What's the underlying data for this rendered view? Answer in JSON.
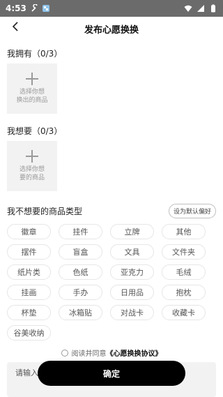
{
  "status_bar": {
    "time": "4:53",
    "left_icons": [
      "wrench-icon",
      "app-notification-icon"
    ],
    "right_icons": [
      "wifi-icon",
      "signal-icon",
      "battery-icon"
    ]
  },
  "header": {
    "title": "发布心愿换换",
    "back_icon": "chevron-left-icon"
  },
  "have_section": {
    "label": "我拥有（0/3）",
    "upload_text": "选择你想\n换出的商品"
  },
  "want_section": {
    "label": "我想要（0/3）",
    "upload_text": "选择你想\n要的商品"
  },
  "unwanted_types": {
    "label": "我不想要的商品类型",
    "default_button": "设为默认偏好",
    "tags": [
      "徽章",
      "挂件",
      "立牌",
      "其他",
      "摆件",
      "盲盒",
      "文具",
      "文件夹",
      "纸片类",
      "色纸",
      "亚克力",
      "毛绒",
      "挂画",
      "手办",
      "日用品",
      "抱枕",
      "杯垫",
      "冰箱贴",
      "对战卡",
      "收藏卡",
      "谷美收纳"
    ]
  },
  "agreement": {
    "prefix": "阅读并同意",
    "link": "《心愿换换协议》"
  },
  "bottom": {
    "input_value": "请输入",
    "confirm_label": "确定"
  },
  "colors": {
    "status_bar_bg": "#6b6b6b",
    "confirm_bg": "#000000",
    "upload_bg": "#f2f2f2"
  }
}
